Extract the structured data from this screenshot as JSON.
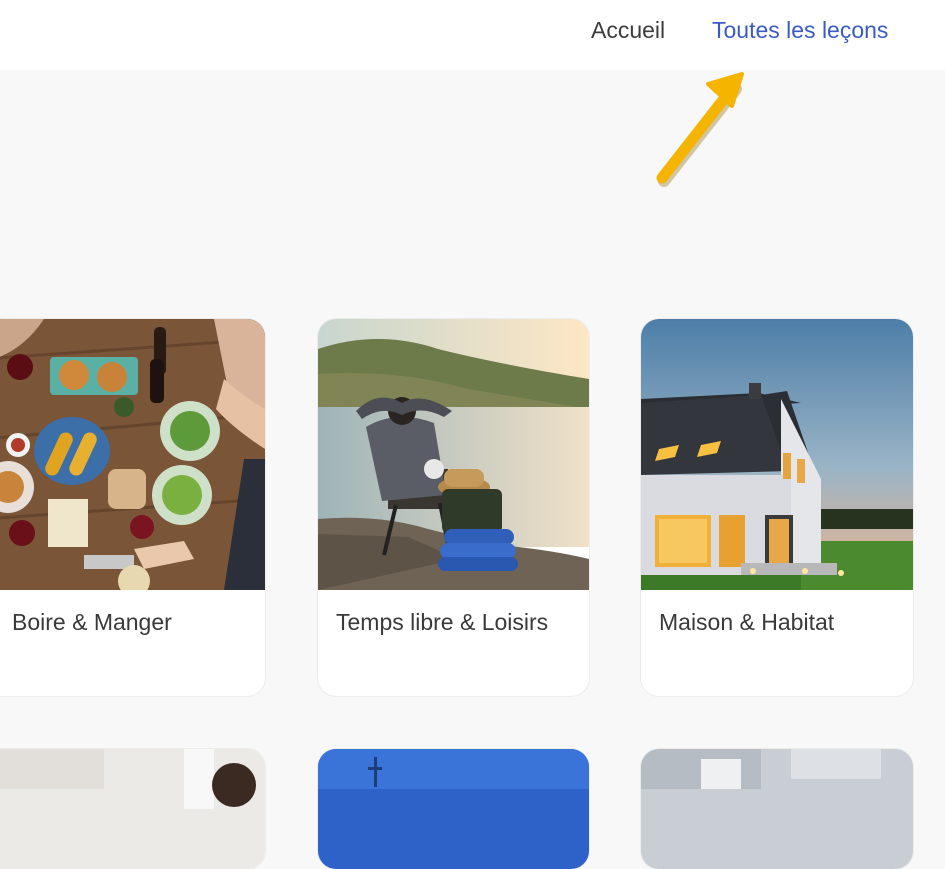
{
  "nav": {
    "home_label": "Accueil",
    "lessons_label": "Toutes les leçons"
  },
  "annotation": {
    "arrow_color": "#f5b400"
  },
  "cards": [
    {
      "title": "Boire & Manger"
    },
    {
      "title": "Temps libre & Loisirs"
    },
    {
      "title": "Maison & Habitat"
    }
  ],
  "colors": {
    "link_active": "#3b5bc4",
    "link_default": "#3d3d3d",
    "page_background": "#f8f8f8"
  }
}
